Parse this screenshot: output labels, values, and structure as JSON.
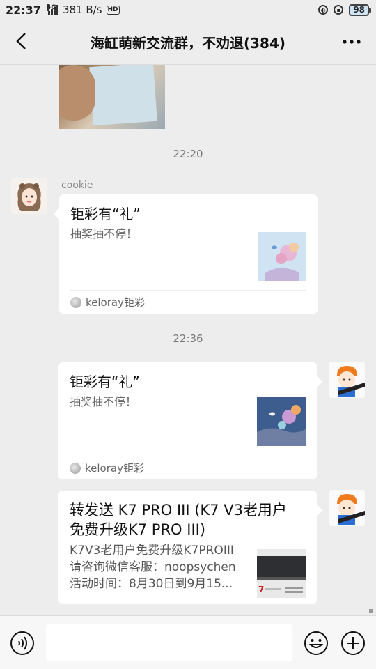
{
  "status_bar": {
    "time": "22:37",
    "network": "4G",
    "speed": "381 B/s",
    "hd": "HD",
    "battery": "98"
  },
  "header": {
    "title": "海缸萌新交流群，不劝退(384)"
  },
  "messages": {
    "time_1": "22:20",
    "time_2": "22:36",
    "msg_cookie": {
      "sender": "cookie",
      "title": "钜彩有“礼”",
      "desc": "抽奖抽不停！",
      "source": "keloray钜彩"
    },
    "msg_self_1": {
      "title": "钜彩有“礼”",
      "desc": "抽奖抽不停！",
      "source": "keloray钜彩"
    },
    "msg_self_2": {
      "title": "转发送 K7 PRO III (K7 V3老用户免费升级K7 PRO III)",
      "desc_line1": "K7V3老用户免费升级K7PROIII",
      "desc_line2": "请咨询微信客服：noopsychen",
      "desc_line3": "活动时间：8月30日到9月15..."
    }
  },
  "input_bar": {
    "placeholder": ""
  }
}
